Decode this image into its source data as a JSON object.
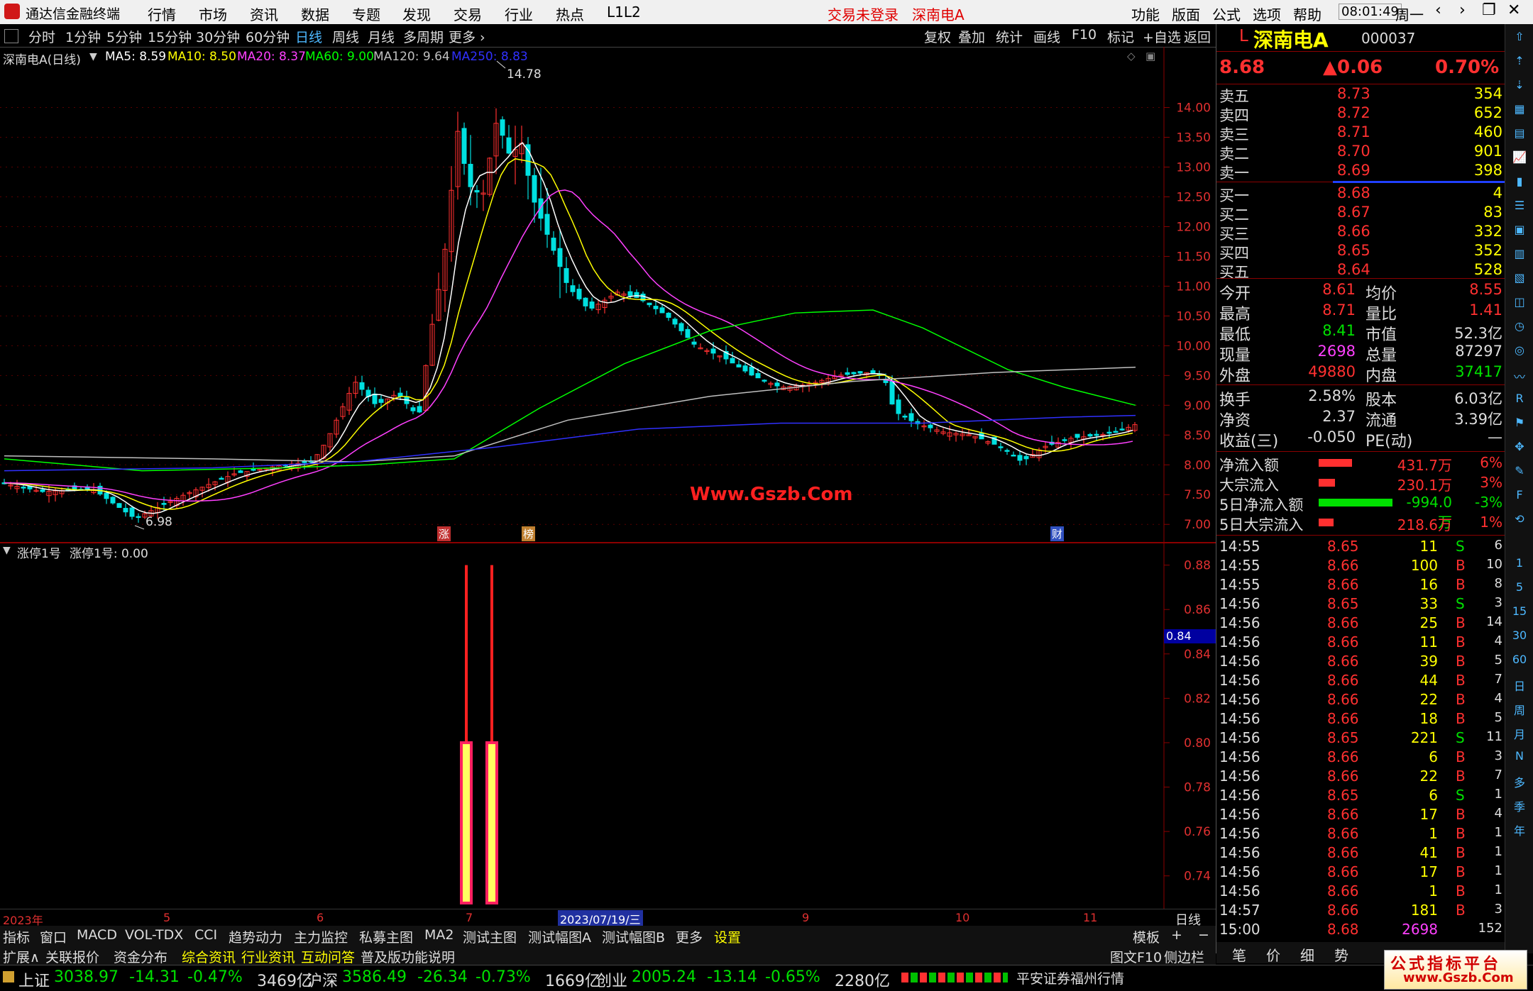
{
  "titlebar": {
    "app_name": "通达信金融终端",
    "menus": [
      "行情",
      "市场",
      "资讯",
      "数据",
      "专题",
      "发现",
      "交易",
      "行业",
      "热点",
      "L1L2"
    ],
    "login_status": "交易未登录",
    "stock_name": "深南电A",
    "right_menus": [
      "功能",
      "版面",
      "公式",
      "选项",
      "帮助"
    ],
    "time": "08:01:49",
    "weekday": "周一"
  },
  "toolbar": {
    "periods": [
      "分时",
      "1分钟",
      "5分钟",
      "15分钟",
      "30分钟",
      "60分钟",
      "日线",
      "周线",
      "月线",
      "多周期",
      "更多 ›"
    ],
    "active_period": "日线",
    "buttons": [
      "复权",
      "叠加",
      "统计",
      "画线",
      "F10",
      "标记",
      "+自选",
      "返回"
    ]
  },
  "main_chart": {
    "header": "深南电A(日线)",
    "ma": [
      {
        "label": "MA5: 8.59",
        "color": "#ffffff"
      },
      {
        "label": "MA10: 8.50",
        "color": "#ffff00"
      },
      {
        "label": "MA20: 8.37",
        "color": "#ff40ff"
      },
      {
        "label": "MA60: 9.00",
        "color": "#00ff00"
      },
      {
        "label": "MA120: 9.64",
        "color": "#c0c0c0"
      },
      {
        "label": "MA250: 8.83",
        "color": "#3030ff"
      }
    ],
    "high_label": "14.78",
    "low_label": "6.98",
    "watermark": "Www.Gszb.Com",
    "price_ticks": [
      "14.00",
      "13.50",
      "13.00",
      "12.50",
      "12.00",
      "11.50",
      "11.00",
      "10.50",
      "10.00",
      "9.50",
      "9.00",
      "8.50",
      "8.00",
      "7.50",
      "7.00"
    ],
    "markers": [
      "涨",
      "榜",
      "财"
    ]
  },
  "sub_chart": {
    "header_name": "涨停1号",
    "header_value": "涨停1号: 0.00",
    "ticks": [
      "0.88",
      "0.86",
      "0.84",
      "0.82",
      "0.80",
      "0.78",
      "0.76",
      "0.74"
    ],
    "current_value": "0.84"
  },
  "date_axis": {
    "labels": [
      "2023年",
      "5",
      "6",
      "7",
      "9",
      "10",
      "11"
    ],
    "cursor_date": "2023/07/19/三",
    "period": "日线"
  },
  "tabs_row1": [
    "指标",
    "窗口",
    "MACD",
    "VOL-TDX",
    "CCI",
    "趋势动力",
    "主力监控",
    "私募主图",
    "MA2",
    "测试主图",
    "测试幅图A",
    "测试幅图B",
    "更多",
    "设置"
  ],
  "tabs_row1_right": [
    "模板",
    "+",
    "−"
  ],
  "tabs_row2": [
    "扩展∧",
    "关联报价",
    "资金分布",
    "综合资讯",
    "行业资讯",
    "互动问答",
    "普及版功能说明"
  ],
  "tabs_row2_right": [
    "图文F10",
    "侧边栏《"
  ],
  "quote": {
    "prefix": "L",
    "name": "深南电A",
    "code": "000037",
    "price": "8.68",
    "change": "▲0.06",
    "pct": "0.70%",
    "asks": [
      {
        "label": "卖五",
        "price": "8.73",
        "vol": "354"
      },
      {
        "label": "卖四",
        "price": "8.72",
        "vol": "652"
      },
      {
        "label": "卖三",
        "price": "8.71",
        "vol": "460"
      },
      {
        "label": "卖二",
        "price": "8.70",
        "vol": "901"
      },
      {
        "label": "卖一",
        "price": "8.69",
        "vol": "398"
      }
    ],
    "bids": [
      {
        "label": "买一",
        "price": "8.68",
        "vol": "4"
      },
      {
        "label": "买二",
        "price": "8.67",
        "vol": "83"
      },
      {
        "label": "买三",
        "price": "8.66",
        "vol": "332"
      },
      {
        "label": "买四",
        "price": "8.65",
        "vol": "352"
      },
      {
        "label": "买五",
        "price": "8.64",
        "vol": "528"
      }
    ],
    "stats": [
      {
        "l1": "今开",
        "v1": "8.61",
        "l2": "均价",
        "v2": "8.55",
        "c1": "#ff3030",
        "c2": "#ff3030"
      },
      {
        "l1": "最高",
        "v1": "8.71",
        "l2": "量比",
        "v2": "1.41",
        "c1": "#ff3030",
        "c2": "#ff3030"
      },
      {
        "l1": "最低",
        "v1": "8.41",
        "l2": "市值",
        "v2": "52.3亿",
        "c1": "#00e000",
        "c2": "#dddddd"
      },
      {
        "l1": "现量",
        "v1": "2698",
        "l2": "总量",
        "v2": "87297",
        "c1": "#ff40ff",
        "c2": "#dddddd"
      },
      {
        "l1": "外盘",
        "v1": "49880",
        "l2": "内盘",
        "v2": "37417",
        "c1": "#ff3030",
        "c2": "#00e000"
      }
    ],
    "stats2": [
      {
        "l1": "换手",
        "v1": "2.58%",
        "l2": "股本",
        "v2": "6.03亿"
      },
      {
        "l1": "净资",
        "v1": "2.37",
        "l2": "流通",
        "v2": "3.39亿"
      },
      {
        "l1": "收益(三)",
        "v1": "-0.050",
        "l2": "PE(动)",
        "v2": "—"
      }
    ],
    "flows": [
      {
        "label": "净流入额",
        "value": "431.7万",
        "pct": "6%",
        "bar": 0.45,
        "color": "#ff3030"
      },
      {
        "label": "大宗流入",
        "value": "230.1万",
        "pct": "3%",
        "bar": 0.22,
        "color": "#ff3030"
      },
      {
        "label": "5日净流入额",
        "value": "-994.0万",
        "pct": "-3%",
        "bar": 1.0,
        "color": "#00e000"
      },
      {
        "label": "5日大宗流入",
        "value": "218.6万",
        "pct": "1%",
        "bar": 0.2,
        "color": "#ff3030"
      }
    ],
    "ticks": [
      {
        "t": "14:55",
        "p": "8.65",
        "v": "11",
        "s": "S",
        "n": "6"
      },
      {
        "t": "14:55",
        "p": "8.66",
        "v": "100",
        "s": "B",
        "n": "10"
      },
      {
        "t": "14:55",
        "p": "8.66",
        "v": "16",
        "s": "B",
        "n": "8"
      },
      {
        "t": "14:56",
        "p": "8.65",
        "v": "33",
        "s": "S",
        "n": "3"
      },
      {
        "t": "14:56",
        "p": "8.66",
        "v": "25",
        "s": "B",
        "n": "14"
      },
      {
        "t": "14:56",
        "p": "8.66",
        "v": "11",
        "s": "B",
        "n": "4"
      },
      {
        "t": "14:56",
        "p": "8.66",
        "v": "39",
        "s": "B",
        "n": "5"
      },
      {
        "t": "14:56",
        "p": "8.66",
        "v": "44",
        "s": "B",
        "n": "7"
      },
      {
        "t": "14:56",
        "p": "8.66",
        "v": "22",
        "s": "B",
        "n": "4"
      },
      {
        "t": "14:56",
        "p": "8.66",
        "v": "18",
        "s": "B",
        "n": "5"
      },
      {
        "t": "14:56",
        "p": "8.65",
        "v": "221",
        "s": "S",
        "n": "11"
      },
      {
        "t": "14:56",
        "p": "8.66",
        "v": "6",
        "s": "B",
        "n": "3"
      },
      {
        "t": "14:56",
        "p": "8.66",
        "v": "22",
        "s": "B",
        "n": "7"
      },
      {
        "t": "14:56",
        "p": "8.65",
        "v": "6",
        "s": "S",
        "n": "1"
      },
      {
        "t": "14:56",
        "p": "8.66",
        "v": "17",
        "s": "B",
        "n": "4"
      },
      {
        "t": "14:56",
        "p": "8.66",
        "v": "1",
        "s": "B",
        "n": "1"
      },
      {
        "t": "14:56",
        "p": "8.66",
        "v": "41",
        "s": "B",
        "n": "1"
      },
      {
        "t": "14:56",
        "p": "8.66",
        "v": "17",
        "s": "B",
        "n": "1"
      },
      {
        "t": "14:56",
        "p": "8.66",
        "v": "1",
        "s": "B",
        "n": "1"
      },
      {
        "t": "14:57",
        "p": "8.66",
        "v": "181",
        "s": "B",
        "n": "3"
      },
      {
        "t": "15:00",
        "p": "8.68",
        "v": "2698",
        "s": "",
        "n": "152"
      }
    ],
    "bottom_tabs": [
      "笔",
      "价",
      "细",
      "势"
    ]
  },
  "side_labels": [
    "1",
    "5",
    "15",
    "30",
    "60",
    "日",
    "周",
    "月",
    "N",
    "多",
    "季",
    "年"
  ],
  "statusbar": {
    "indexes": [
      {
        "name": "上证",
        "value": "3038.97",
        "chg": "-14.31",
        "pct": "-0.47%",
        "amt": "3469亿"
      },
      {
        "name": "沪深",
        "value": "3586.49",
        "chg": "-26.34",
        "pct": "-0.73%",
        "amt": "1669亿"
      },
      {
        "name": "创业",
        "value": "2005.24",
        "chg": "-13.14",
        "pct": "-0.65%",
        "amt": "2280亿"
      }
    ],
    "broker": "平安证券福州行情",
    "brand": "公式指标平台",
    "brand_url": "www.Gszb.Com"
  }
}
